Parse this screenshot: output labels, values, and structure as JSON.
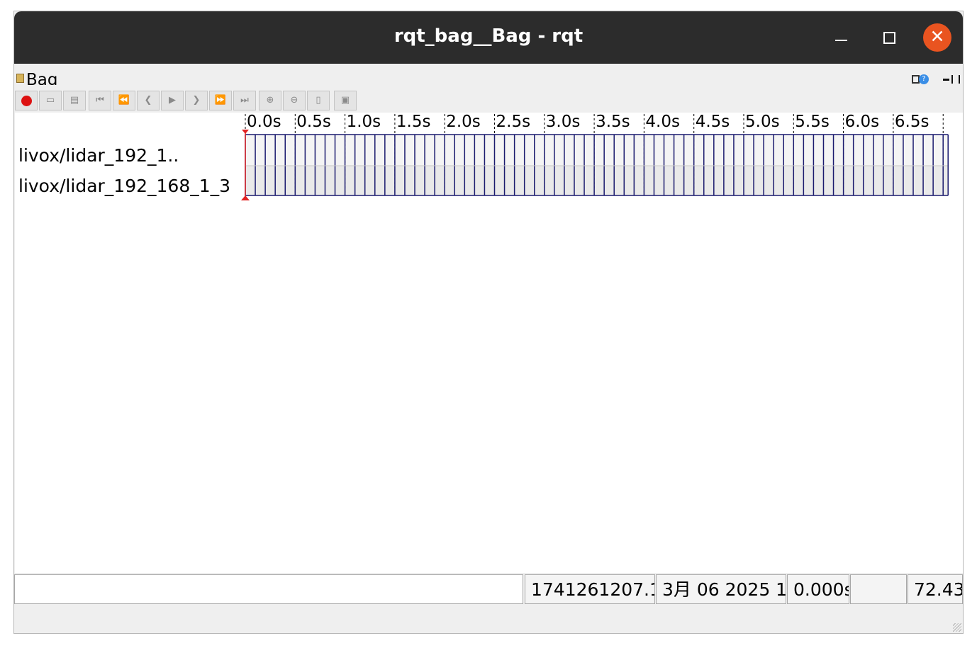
{
  "window": {
    "title": "rqt_bag__Bag - rqt"
  },
  "plugin": {
    "title": "Bag"
  },
  "toolbar": {
    "buttons": [
      {
        "name": "record-button",
        "icon": "record-icon"
      },
      {
        "name": "load-bag-button",
        "icon": "open-folder-icon"
      },
      {
        "name": "save-bag-button",
        "icon": "save-icon"
      },
      {
        "name": "begin-button",
        "icon": "skip-to-start-icon"
      },
      {
        "name": "rewind-button",
        "icon": "rewind-icon"
      },
      {
        "name": "step-back-button",
        "icon": "step-back-icon"
      },
      {
        "name": "play-button",
        "icon": "play-icon"
      },
      {
        "name": "step-forward-button",
        "icon": "step-forward-icon"
      },
      {
        "name": "fast-forward-button",
        "icon": "fast-forward-icon"
      },
      {
        "name": "end-button",
        "icon": "skip-to-end-icon"
      },
      {
        "name": "zoom-in-button",
        "icon": "zoom-in-icon"
      },
      {
        "name": "zoom-out-button",
        "icon": "zoom-out-icon"
      },
      {
        "name": "zoom-all-button",
        "icon": "zoom-all-icon"
      },
      {
        "name": "thumbnails-button",
        "icon": "thumbnail-icon"
      }
    ]
  },
  "timeline": {
    "ticks": [
      "0.0s",
      "0.5s",
      "1.0s",
      "1.5s",
      "2.0s",
      "2.5s",
      "3.0s",
      "3.5s",
      "4.0s",
      "4.5s",
      "5.0s",
      "5.5s",
      "6.0s",
      "6.5s"
    ],
    "tick_step_s": 0.5,
    "end_s": 7.05,
    "message_interval_s": 0.1,
    "topics": [
      "livox/lidar_192_1..",
      "livox/lidar_192_168_1_3"
    ],
    "colors": {
      "message": "#1a1a6e",
      "playhead": "#e22222",
      "gridline": "#000000"
    }
  },
  "status": {
    "input_value": "",
    "timestamp": "1741261207.1",
    "date": "3月 06 2025 1",
    "elapsed": "0.000s",
    "empty": "",
    "rate": "72.43"
  }
}
